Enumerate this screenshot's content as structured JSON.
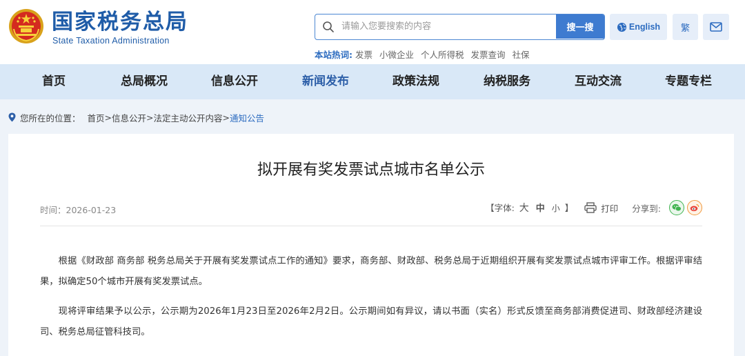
{
  "header": {
    "site_name": "国家税务总局",
    "site_name_en": "State Taxation Administration",
    "search": {
      "placeholder": "请输入您要搜索的内容",
      "button_label": "搜一搜"
    },
    "english_label": "English",
    "traditional_label": "繁",
    "hotwords": {
      "label": "本站热词:",
      "items": [
        "发票",
        "小微企业",
        "个人所得税",
        "发票查询",
        "社保"
      ]
    }
  },
  "nav": {
    "items": [
      "首页",
      "总局概况",
      "信息公开",
      "新闻发布",
      "政策法规",
      "纳税服务",
      "互动交流",
      "专题专栏"
    ],
    "active_index": 3
  },
  "breadcrumb": {
    "label": "您所在的位置：",
    "items": [
      "首页",
      "信息公开",
      "法定主动公开内容",
      "通知公告"
    ],
    "separator": ">"
  },
  "article": {
    "title": "拟开展有奖发票试点城市名单公示",
    "time_label": "时间：",
    "date": "2026-01-23",
    "font_size": {
      "open": "【字体:",
      "large": "大",
      "medium": "中",
      "small": "小",
      "close": "】"
    },
    "print_label": "打印",
    "share_label": "分享到:",
    "paragraphs": [
      "根据《财政部 商务部 税务总局关于开展有奖发票试点工作的通知》要求，商务部、财政部、税务总局于近期组织开展有奖发票试点城市评审工作。根据评审结果，拟确定50个城市开展有奖发票试点。",
      "现将评审结果予以公示，公示期为2026年1月23日至2026年2月2日。公示期间如有异议，请以书面（实名）形式反馈至商务部消费促进司、财政部经济建设司、税务总局征管科技司。"
    ]
  },
  "colors": {
    "brand_blue": "#1f5ca8",
    "accent_blue": "#3e7bd0",
    "nav_bg": "#d9e8f7",
    "page_bg": "#eef3f9"
  }
}
